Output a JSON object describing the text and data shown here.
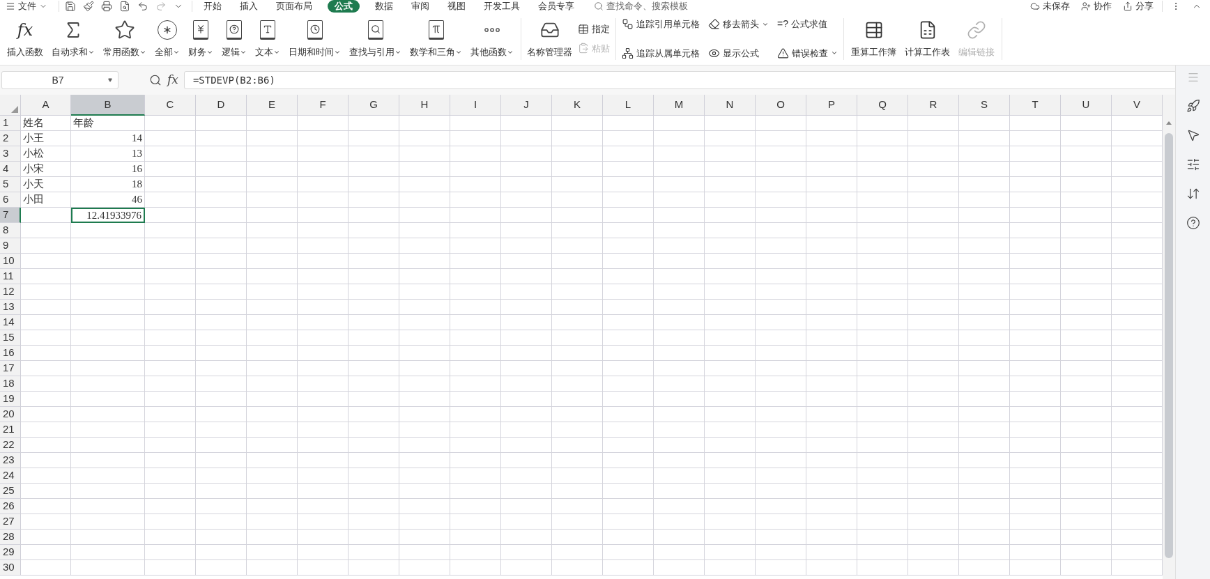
{
  "menu_bar": {
    "file_menu": "文件",
    "tabs": [
      {
        "label": "开始",
        "selected": false
      },
      {
        "label": "插入",
        "selected": false
      },
      {
        "label": "页面布局",
        "selected": false
      },
      {
        "label": "公式",
        "selected": true
      },
      {
        "label": "数据",
        "selected": false
      },
      {
        "label": "审阅",
        "selected": false
      },
      {
        "label": "视图",
        "selected": false
      },
      {
        "label": "开发工具",
        "selected": false
      },
      {
        "label": "会员专享",
        "selected": false
      }
    ],
    "search": {
      "placeholder": "查找命令、搜索模板"
    },
    "actions": [
      "未保存",
      "协作",
      "分享"
    ]
  },
  "ribbon": {
    "function_buttons": [
      {
        "label": "插入函数",
        "glyph": "fx",
        "dropdown": false
      },
      {
        "label": "自动求和",
        "dropdown": true
      },
      {
        "label": "常用函数",
        "dropdown": true
      },
      {
        "label": "全部",
        "dropdown": true
      },
      {
        "label": "财务",
        "dropdown": true
      },
      {
        "label": "逻辑",
        "dropdown": true
      },
      {
        "label": "文本",
        "dropdown": true
      },
      {
        "label": "日期和时间",
        "dropdown": true
      },
      {
        "label": "查找与引用",
        "dropdown": true
      },
      {
        "label": "数学和三角",
        "dropdown": true
      },
      {
        "label": "其他函数",
        "dropdown": true
      }
    ],
    "name_group": {
      "manager": "名称管理器",
      "small": [
        {
          "label": "指定",
          "disabled": false
        },
        {
          "label": "粘贴",
          "disabled": true
        }
      ]
    },
    "audit_group": [
      {
        "label": "追踪引用单元格",
        "dropdown": false
      },
      {
        "label": "追踪从属单元格",
        "dropdown": false
      },
      {
        "label": "移去箭头",
        "dropdown": true
      },
      {
        "label": "显示公式",
        "dropdown": false
      },
      {
        "label": "公式求值",
        "glyph": "=?",
        "dropdown": false
      },
      {
        "label": "错误检查",
        "dropdown": true
      }
    ],
    "calc_group": [
      {
        "label": "重算工作簿",
        "disabled": false
      },
      {
        "label": "计算工作表",
        "disabled": false
      },
      {
        "label": "编辑链接",
        "disabled": true
      }
    ]
  },
  "formula_bar": {
    "name_box": "B7",
    "fx": "fx",
    "formula": "=STDEVP(B2:B6)"
  },
  "sheet": {
    "columns": [
      {
        "label": "A",
        "selected": false
      },
      {
        "label": "B",
        "selected": true
      },
      {
        "label": "C",
        "selected": false
      },
      {
        "label": "D",
        "selected": false
      },
      {
        "label": "E",
        "selected": false
      },
      {
        "label": "F",
        "selected": false
      },
      {
        "label": "G",
        "selected": false
      },
      {
        "label": "H",
        "selected": false
      },
      {
        "label": "I",
        "selected": false
      },
      {
        "label": "J",
        "selected": false
      },
      {
        "label": "K",
        "selected": false
      },
      {
        "label": "L",
        "selected": false
      },
      {
        "label": "M",
        "selected": false
      },
      {
        "label": "N",
        "selected": false
      },
      {
        "label": "O",
        "selected": false
      },
      {
        "label": "P",
        "selected": false
      },
      {
        "label": "Q",
        "selected": false
      },
      {
        "label": "R",
        "selected": false
      },
      {
        "label": "S",
        "selected": false
      },
      {
        "label": "T",
        "selected": false
      },
      {
        "label": "U",
        "selected": false
      },
      {
        "label": "V",
        "selected": false
      }
    ],
    "rows": [
      {
        "label": "1",
        "selected": false,
        "cells": [
          {
            "text": "姓名",
            "kind": "text",
            "selected": false
          },
          {
            "text": "年龄",
            "kind": "text",
            "selected": false
          }
        ]
      },
      {
        "label": "2",
        "selected": false,
        "cells": [
          {
            "text": "小王",
            "kind": "text",
            "selected": false
          },
          {
            "text": "14",
            "kind": "number",
            "selected": false
          }
        ]
      },
      {
        "label": "3",
        "selected": false,
        "cells": [
          {
            "text": "小松",
            "kind": "text",
            "selected": false
          },
          {
            "text": "13",
            "kind": "number",
            "selected": false
          }
        ]
      },
      {
        "label": "4",
        "selected": false,
        "cells": [
          {
            "text": "小宋",
            "kind": "text",
            "selected": false
          },
          {
            "text": "16",
            "kind": "number",
            "selected": false
          }
        ]
      },
      {
        "label": "5",
        "selected": false,
        "cells": [
          {
            "text": "小天",
            "kind": "text",
            "selected": false
          },
          {
            "text": "18",
            "kind": "number",
            "selected": false
          }
        ]
      },
      {
        "label": "6",
        "selected": false,
        "cells": [
          {
            "text": "小田",
            "kind": "text",
            "selected": false
          },
          {
            "text": "46",
            "kind": "number",
            "selected": false
          }
        ]
      },
      {
        "label": "7",
        "selected": true,
        "cells": [
          null,
          {
            "text": "12.41933976",
            "kind": "number",
            "selected": true
          }
        ]
      },
      {
        "label": "8",
        "selected": false
      },
      {
        "label": "9",
        "selected": false
      },
      {
        "label": "10",
        "selected": false
      },
      {
        "label": "11",
        "selected": false
      },
      {
        "label": "12",
        "selected": false
      },
      {
        "label": "13",
        "selected": false
      },
      {
        "label": "14",
        "selected": false
      },
      {
        "label": "15",
        "selected": false
      },
      {
        "label": "16",
        "selected": false
      },
      {
        "label": "17",
        "selected": false
      },
      {
        "label": "18",
        "selected": false
      },
      {
        "label": "19",
        "selected": false
      },
      {
        "label": "20",
        "selected": false
      },
      {
        "label": "21",
        "selected": false
      },
      {
        "label": "22",
        "selected": false
      },
      {
        "label": "23",
        "selected": false
      },
      {
        "label": "24",
        "selected": false
      },
      {
        "label": "25",
        "selected": false
      },
      {
        "label": "26",
        "selected": false
      },
      {
        "label": "27",
        "selected": false
      },
      {
        "label": "28",
        "selected": false
      },
      {
        "label": "29",
        "selected": false
      },
      {
        "label": "30",
        "selected": false
      }
    ]
  }
}
